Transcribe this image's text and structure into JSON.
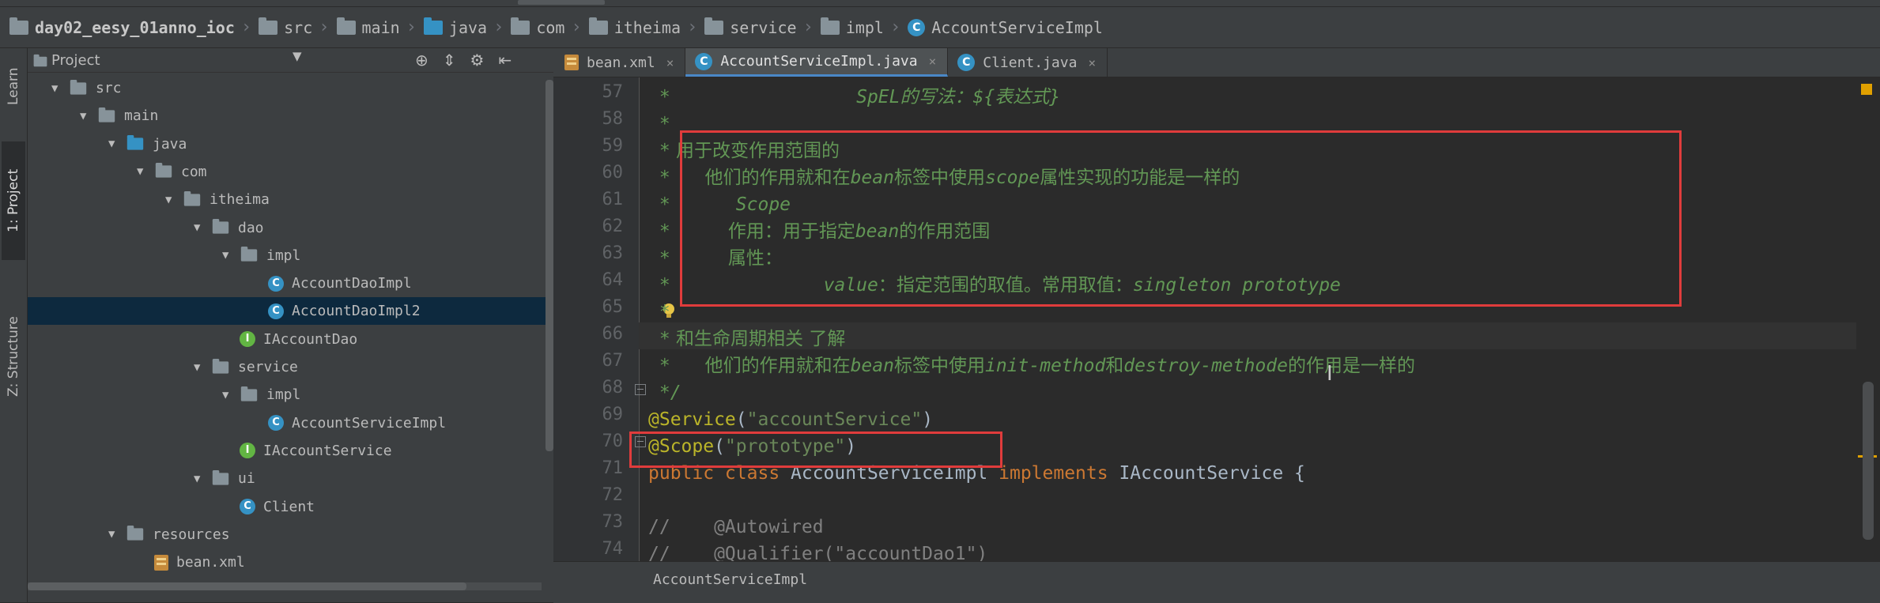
{
  "breadcrumb": [
    "day02_eesy_01anno_ioc",
    "src",
    "main",
    "java",
    "com",
    "itheima",
    "service",
    "impl",
    "AccountServiceImpl"
  ],
  "left_strip": {
    "learn": "Learn",
    "project": "1: Project",
    "structure": "Z: Structure"
  },
  "project_panel": {
    "title": "Project",
    "tree": [
      {
        "label": "src",
        "type": "folder",
        "depth": 0
      },
      {
        "label": "main",
        "type": "folder",
        "depth": 1
      },
      {
        "label": "java",
        "type": "folder-blue",
        "depth": 2
      },
      {
        "label": "com",
        "type": "package",
        "depth": 3
      },
      {
        "label": "itheima",
        "type": "package",
        "depth": 4
      },
      {
        "label": "dao",
        "type": "package",
        "depth": 5
      },
      {
        "label": "impl",
        "type": "package",
        "depth": 6
      },
      {
        "label": "AccountDaoImpl",
        "type": "class",
        "depth": 7
      },
      {
        "label": "AccountDaoImpl2",
        "type": "class",
        "depth": 7,
        "selected": true
      },
      {
        "label": "IAccountDao",
        "type": "interface",
        "depth": 6
      },
      {
        "label": "service",
        "type": "package",
        "depth": 5
      },
      {
        "label": "impl",
        "type": "package",
        "depth": 6
      },
      {
        "label": "AccountServiceImpl",
        "type": "class",
        "depth": 7
      },
      {
        "label": "IAccountService",
        "type": "interface",
        "depth": 6
      },
      {
        "label": "ui",
        "type": "package",
        "depth": 5
      },
      {
        "label": "Client",
        "type": "class",
        "depth": 6
      },
      {
        "label": "resources",
        "type": "folder",
        "depth": 2
      },
      {
        "label": "bean.xml",
        "type": "xml",
        "depth": 3
      }
    ]
  },
  "tabs": [
    {
      "label": "bean.xml",
      "icon": "xml-file-icon",
      "active": false
    },
    {
      "label": "AccountServiceImpl.java",
      "icon": "class-icon",
      "active": true
    },
    {
      "label": "Client.java",
      "icon": "class-icon",
      "active": false
    }
  ],
  "tab_close": "×",
  "editor": {
    "line_numbers": [
      "57",
      "58",
      "59",
      "60",
      "61",
      "62",
      "63",
      "64",
      "65",
      "66",
      "67",
      "68",
      "69",
      "70",
      "71",
      "72",
      "73",
      "74"
    ],
    "lines": {
      "l57": {
        "star": " *",
        "text": "                 SpEL的写法：${表达式}"
      },
      "l58": {
        "star": " *",
        "text": ""
      },
      "l59": {
        "star": " *",
        "text": " 用于改变作用范围的"
      },
      "l60": {
        "star": " *",
        "text_a": "      他们的作用就和在",
        "i1": "bean",
        "text_b": "标签中使用",
        "i2": "scope",
        "text_c": "属性实现的功能是一样的"
      },
      "l61": {
        "star": " *",
        "text": "      Scope"
      },
      "l62": {
        "star": " *",
        "text_a": "          作用：用于指定",
        "i1": "bean",
        "text_b": "的作用范围"
      },
      "l63": {
        "star": " *",
        "text": "          属性："
      },
      "l64": {
        "star": " *",
        "i1": "              value",
        "text_a": "：指定范围的取值。常用取值：",
        "i2": "singleton prototype"
      },
      "l65": {
        "star": " *",
        "text": ""
      },
      "l66": {
        "star": " *",
        "text": " 和生命周期相关 了解"
      },
      "l67": {
        "star": " *",
        "text_a": "      他们的作用就和在",
        "i1": "bean",
        "text_b": "标签中使用",
        "i2": "init-method",
        "text_c": "和",
        "i3": "destroy-methode",
        "text_d": "的作用是一样的"
      },
      "l68": {
        "star": " */",
        "text": ""
      },
      "l69": {
        "ann": "@Service",
        "open": "(",
        "str": "\"accountService\"",
        "close": ")"
      },
      "l70": {
        "ann": "@Scope",
        "open": "(",
        "str": "\"prototype\"",
        "close": ")"
      },
      "l71": {
        "kw1": "public class ",
        "cls": "AccountServiceImpl ",
        "kw2": "implements ",
        "iface": "IAccountService {"
      },
      "l72": {
        "text": ""
      },
      "l73": {
        "cmt": "//    @Autowired"
      },
      "l74": {
        "cmt": "//    @Qualifier(\"accountDao1\")"
      }
    }
  },
  "status": {
    "text": "AccountServiceImpl"
  }
}
